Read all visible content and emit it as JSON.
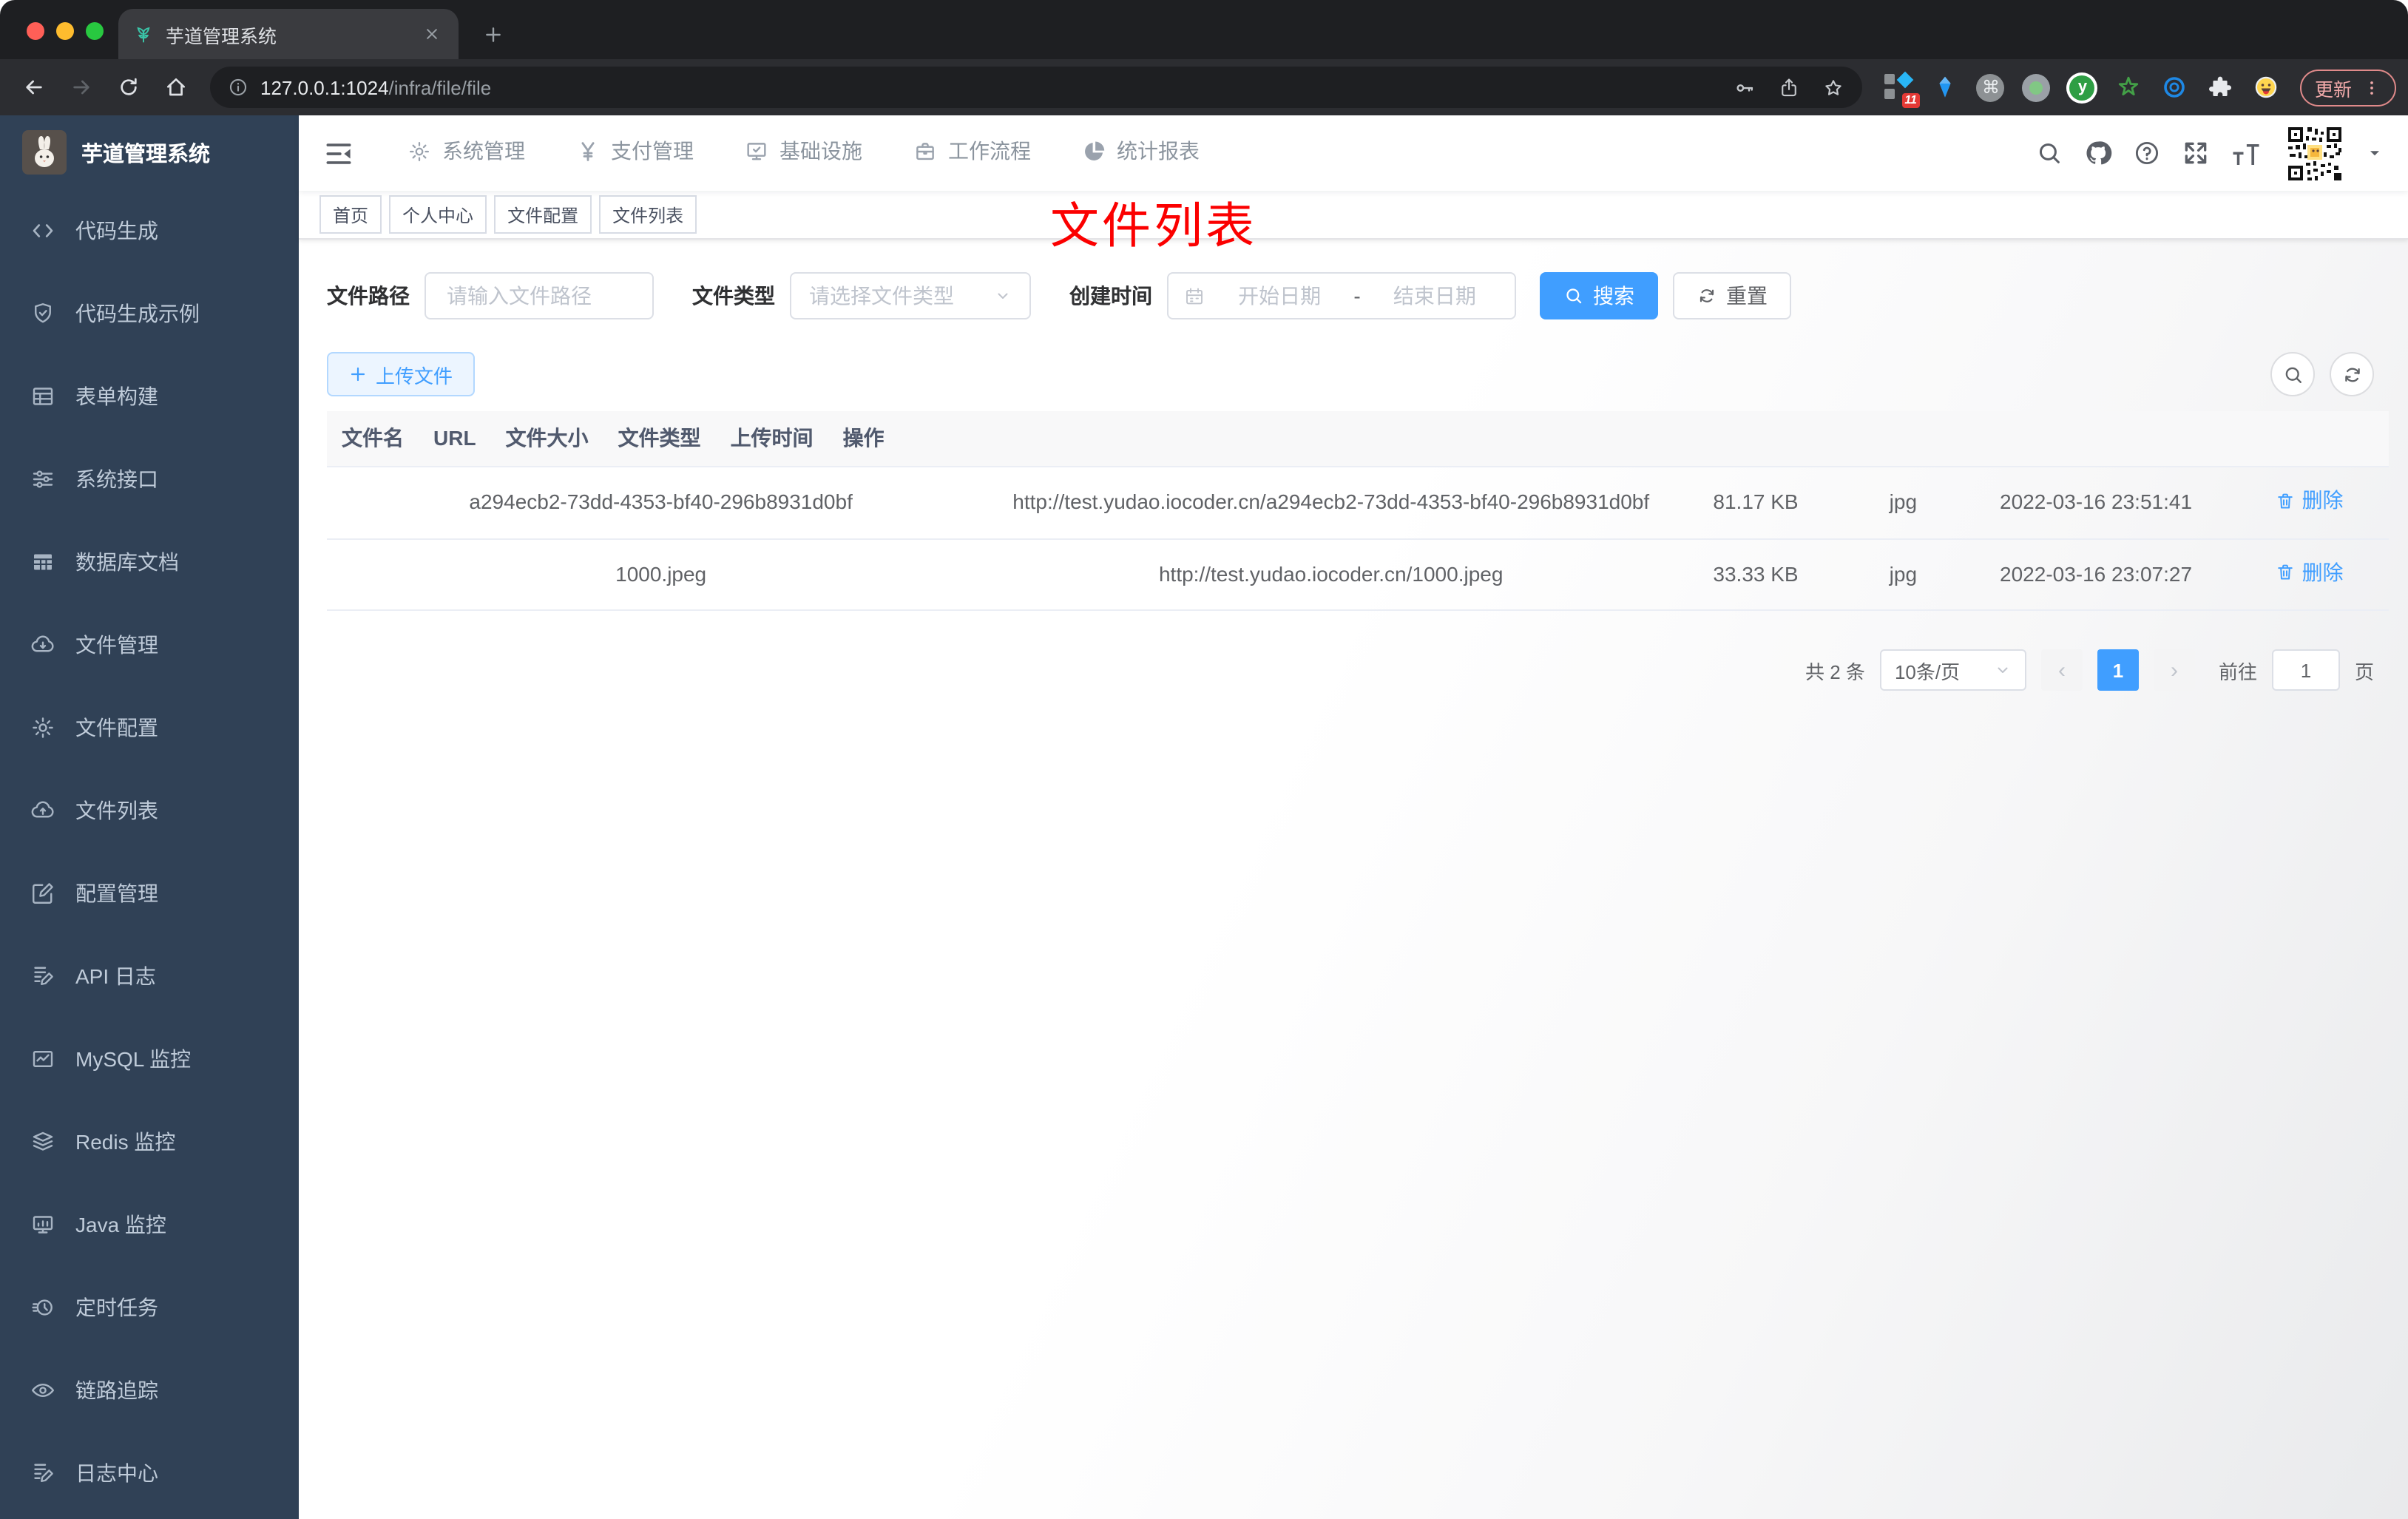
{
  "browser": {
    "tab_title": "芋道管理系统",
    "url_host": "127.0.0.1:1024",
    "url_path": "/infra/file/file",
    "ext_badge": "11",
    "ext_letter": "y",
    "update_label": "更新"
  },
  "icons": {
    "prev": "‹",
    "next": "›",
    "command": "⌘"
  },
  "sidebar": {
    "title": "芋道管理系统",
    "items": [
      {
        "label": "代码生成",
        "icon": "code",
        "classes": "lv1"
      },
      {
        "label": "代码生成示例",
        "icon": "shield",
        "classes": "lv1"
      },
      {
        "label": "表单构建",
        "icon": "form",
        "classes": "lv1"
      },
      {
        "label": "系统接口",
        "icon": "sliders",
        "classes": "lv1"
      },
      {
        "label": "数据库文档",
        "icon": "dbtable",
        "classes": "lv1"
      },
      {
        "label": "文件管理",
        "icon": "cloud-down",
        "classes": "lv1",
        "chevron_icon": "chevron-up"
      },
      {
        "label": "文件配置",
        "icon": "gear",
        "classes": "lv2"
      },
      {
        "label": "文件列表",
        "icon": "cloud-up",
        "classes": "lv2 active"
      },
      {
        "label": "配置管理",
        "icon": "edit-square",
        "classes": "lv1"
      },
      {
        "label": "API 日志",
        "icon": "doc-edit",
        "classes": "lv1",
        "chevron_icon": "chevron-down"
      },
      {
        "label": "MySQL 监控",
        "icon": "chart",
        "classes": "lv1"
      },
      {
        "label": "Redis 监控",
        "icon": "layers",
        "classes": "lv1"
      },
      {
        "label": "Java 监控",
        "icon": "monitor",
        "classes": "lv1"
      },
      {
        "label": "定时任务",
        "icon": "clock",
        "classes": "lv1"
      },
      {
        "label": "链路追踪",
        "icon": "eye",
        "classes": "lv1"
      },
      {
        "label": "日志中心",
        "icon": "doc-edit",
        "classes": "lv1"
      }
    ]
  },
  "topnav": {
    "items": [
      {
        "label": "系统管理",
        "icon": "gear"
      },
      {
        "label": "支付管理",
        "icon": "yen"
      },
      {
        "label": "基础设施",
        "icon": "monitor-check",
        "classes": "active"
      },
      {
        "label": "工作流程",
        "icon": "briefcase"
      },
      {
        "label": "统计报表",
        "icon": "pie"
      }
    ]
  },
  "tags": [
    {
      "label": "首页"
    },
    {
      "label": "个人中心",
      "closable": true
    },
    {
      "label": "文件配置",
      "closable": true
    },
    {
      "label": "文件列表",
      "closable": true,
      "classes": "active",
      "dot": true
    }
  ],
  "annotation": {
    "text": "文件列表",
    "color": "#fb0000"
  },
  "filters": {
    "path_label": "文件路径",
    "path_placeholder": "请输入文件路径",
    "type_label": "文件类型",
    "type_placeholder": "请选择文件类型",
    "date_label": "创建时间",
    "date_start_placeholder": "开始日期",
    "date_separator": "-",
    "date_end_placeholder": "结束日期",
    "search_label": "搜索",
    "reset_label": "重置"
  },
  "toolbar": {
    "upload_label": "上传文件"
  },
  "table": {
    "headers": [
      "文件名",
      "URL",
      "文件大小",
      "文件类型",
      "上传时间",
      "操作"
    ],
    "rows": [
      {
        "name": "a294ecb2-73dd-4353-bf40-296b8931d0bf",
        "url": "http://test.yudao.iocoder.cn/a294ecb2-73dd-4353-bf40-296b8931d0bf",
        "size": "81.17 KB",
        "type": "jpg",
        "time": "2022-03-16 23:51:41",
        "action": "删除"
      },
      {
        "name": "1000.jpeg",
        "url": "http://test.yudao.iocoder.cn/1000.jpeg",
        "size": "33.33 KB",
        "type": "jpg",
        "time": "2022-03-16 23:07:27",
        "action": "删除"
      }
    ]
  },
  "pagination": {
    "total": "共 2 条",
    "page_size": "10条/页",
    "current_page": "1",
    "goto_label": "前往",
    "goto_value": "1",
    "page_unit": "页"
  },
  "colors": {
    "accent": "#409eff",
    "sidebar_bg": "#304156",
    "submenu_bg": "#1f2d3d"
  }
}
